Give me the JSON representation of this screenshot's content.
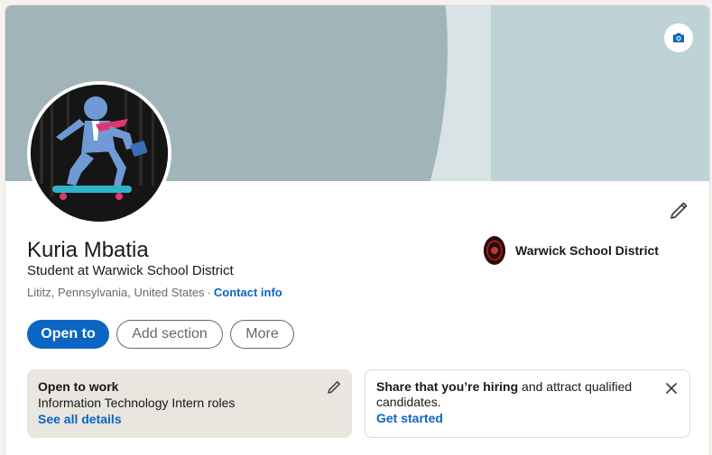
{
  "profile": {
    "name": "Kuria Mbatia",
    "headline": "Student at Warwick School District",
    "location": "Lititz, Pennsylvania, United States",
    "separator": "·",
    "contact_info_label": "Contact info"
  },
  "company": {
    "name": "Warwick School District"
  },
  "actions": {
    "open_to_label": "Open to",
    "add_section_label": "Add section",
    "more_label": "More"
  },
  "open_to_work": {
    "title": "Open to work",
    "roles": "Information Technology Intern roles",
    "link_label": "See all details"
  },
  "hiring": {
    "bold_text": "Share that you’re hiring",
    "rest_text": " and attract qualified candidates.",
    "link_label": "Get started"
  },
  "icons": {
    "banner_camera": "camera-icon",
    "edit_profile": "pencil-icon",
    "otw_edit": "pencil-icon",
    "hiring_close": "close-icon"
  },
  "colors": {
    "accent": "#0a66c2",
    "banner": "#bfd2d6",
    "banner_arc": "#a1b4b9",
    "otw_bg": "#e9e5df"
  }
}
